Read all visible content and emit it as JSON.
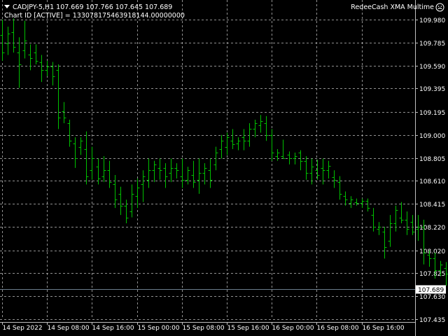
{
  "header": {
    "symbol_line": "CADJPY-5,H1  107.669 107.766 107.645 107.689",
    "chart_id": "Chart ID [ACTIVE] = 133078175463918144.00000000",
    "indicator_label": "RedeeCash XMA Multime"
  },
  "icons": {
    "menu": "chevron-down-icon",
    "indicator": "smiley-icon"
  },
  "colors": {
    "background": "#000000",
    "candle": "#00c000",
    "grid": "#c0c0c0",
    "current_price_line": "#6b7c8c",
    "price_label_bg": "#ffffff",
    "text": "#ffffff"
  },
  "current_price": {
    "value": 107.689,
    "label": "107.689"
  },
  "chart_data": {
    "type": "bar",
    "symbol": "CADJPY-5",
    "timeframe": "H1",
    "ylim": [
      107.435,
      109.98
    ],
    "y_ticks": [
      109.98,
      109.785,
      109.59,
      109.395,
      109.195,
      109.0,
      108.805,
      108.61,
      108.415,
      108.22,
      108.02,
      107.825,
      107.63,
      107.435
    ],
    "x_tick_labels": [
      "14 Sep 2022",
      "14 Sep 08:00",
      "14 Sep 16:00",
      "15 Sep 00:00",
      "15 Sep 08:00",
      "15 Sep 16:00",
      "16 Sep 00:00",
      "16 Sep 08:00",
      "16 Sep 16:00"
    ],
    "grid": true,
    "bars": [
      {
        "open": 109.85,
        "high": 109.98,
        "low": 109.63,
        "close": 109.7
      },
      {
        "open": 109.78,
        "high": 109.92,
        "low": 109.68,
        "close": 109.86
      },
      {
        "open": 109.87,
        "high": 109.99,
        "low": 109.7,
        "close": 109.75
      },
      {
        "open": 109.7,
        "high": 109.83,
        "low": 109.4,
        "close": 109.6
      },
      {
        "open": 109.72,
        "high": 109.97,
        "low": 109.65,
        "close": 109.8
      },
      {
        "open": 109.68,
        "high": 109.77,
        "low": 109.55,
        "close": 109.65
      },
      {
        "open": 109.7,
        "high": 109.77,
        "low": 109.6,
        "close": 109.63
      },
      {
        "open": 109.62,
        "high": 109.68,
        "low": 109.45,
        "close": 109.55
      },
      {
        "open": 109.55,
        "high": 109.63,
        "low": 109.5,
        "close": 109.58
      },
      {
        "open": 109.58,
        "high": 109.62,
        "low": 109.42,
        "close": 109.5
      },
      {
        "open": 109.55,
        "high": 109.6,
        "low": 109.05,
        "close": 109.15
      },
      {
        "open": 109.2,
        "high": 109.28,
        "low": 109.1,
        "close": 109.15
      },
      {
        "open": 109.1,
        "high": 109.13,
        "low": 108.9,
        "close": 108.95
      },
      {
        "open": 108.93,
        "high": 108.98,
        "low": 108.72,
        "close": 108.8
      },
      {
        "open": 108.9,
        "high": 108.98,
        "low": 108.83,
        "close": 108.95
      },
      {
        "open": 108.88,
        "high": 109.03,
        "low": 108.58,
        "close": 108.65
      },
      {
        "open": 108.7,
        "high": 108.9,
        "low": 108.62,
        "close": 108.8
      },
      {
        "open": 108.73,
        "high": 108.8,
        "low": 108.58,
        "close": 108.63
      },
      {
        "open": 108.65,
        "high": 108.82,
        "low": 108.6,
        "close": 108.7
      },
      {
        "open": 108.7,
        "high": 108.78,
        "low": 108.55,
        "close": 108.6
      },
      {
        "open": 108.58,
        "high": 108.66,
        "low": 108.38,
        "close": 108.45
      },
      {
        "open": 108.5,
        "high": 108.56,
        "low": 108.32,
        "close": 108.4
      },
      {
        "open": 108.4,
        "high": 108.45,
        "low": 108.25,
        "close": 108.3
      },
      {
        "open": 108.35,
        "high": 108.58,
        "low": 108.3,
        "close": 108.5
      },
      {
        "open": 108.48,
        "high": 108.63,
        "low": 108.38,
        "close": 108.55
      },
      {
        "open": 108.58,
        "high": 108.7,
        "low": 108.43,
        "close": 108.65
      },
      {
        "open": 108.62,
        "high": 108.8,
        "low": 108.55,
        "close": 108.7
      },
      {
        "open": 108.7,
        "high": 108.78,
        "low": 108.6,
        "close": 108.75
      },
      {
        "open": 108.72,
        "high": 108.8,
        "low": 108.62,
        "close": 108.7
      },
      {
        "open": 108.72,
        "high": 108.76,
        "low": 108.55,
        "close": 108.65
      },
      {
        "open": 108.68,
        "high": 108.8,
        "low": 108.6,
        "close": 108.72
      },
      {
        "open": 108.72,
        "high": 108.76,
        "low": 108.63,
        "close": 108.7
      },
      {
        "open": 108.65,
        "high": 108.8,
        "low": 108.55,
        "close": 108.62
      },
      {
        "open": 108.62,
        "high": 108.73,
        "low": 108.58,
        "close": 108.7
      },
      {
        "open": 108.66,
        "high": 108.78,
        "low": 108.55,
        "close": 108.6
      },
      {
        "open": 108.62,
        "high": 108.8,
        "low": 108.5,
        "close": 108.68
      },
      {
        "open": 108.68,
        "high": 108.76,
        "low": 108.58,
        "close": 108.72
      },
      {
        "open": 108.7,
        "high": 108.8,
        "low": 108.55,
        "close": 108.62
      },
      {
        "open": 108.75,
        "high": 108.9,
        "low": 108.7,
        "close": 108.85
      },
      {
        "open": 108.88,
        "high": 109.0,
        "low": 108.8,
        "close": 108.95
      },
      {
        "open": 108.9,
        "high": 109.02,
        "low": 108.83,
        "close": 108.98
      },
      {
        "open": 108.95,
        "high": 109.05,
        "low": 108.88,
        "close": 108.92
      },
      {
        "open": 108.93,
        "high": 108.98,
        "low": 108.87,
        "close": 108.95
      },
      {
        "open": 108.98,
        "high": 109.05,
        "low": 108.87,
        "close": 108.95
      },
      {
        "open": 108.95,
        "high": 109.1,
        "low": 108.9,
        "close": 109.05
      },
      {
        "open": 109.05,
        "high": 109.13,
        "low": 108.98,
        "close": 109.1
      },
      {
        "open": 109.08,
        "high": 109.17,
        "low": 109.02,
        "close": 109.12
      },
      {
        "open": 109.1,
        "high": 109.16,
        "low": 108.95,
        "close": 109.0
      },
      {
        "open": 109.0,
        "high": 109.05,
        "low": 108.78,
        "close": 108.85
      },
      {
        "open": 108.82,
        "high": 108.88,
        "low": 108.78,
        "close": 108.85
      },
      {
        "open": 108.82,
        "high": 108.96,
        "low": 108.8,
        "close": 108.8
      },
      {
        "open": 108.83,
        "high": 108.86,
        "low": 108.75,
        "close": 108.8
      },
      {
        "open": 108.8,
        "high": 108.85,
        "low": 108.75,
        "close": 108.82
      },
      {
        "open": 108.85,
        "high": 108.87,
        "low": 108.7,
        "close": 108.78
      },
      {
        "open": 108.78,
        "high": 108.82,
        "low": 108.62,
        "close": 108.68
      },
      {
        "open": 108.68,
        "high": 108.8,
        "low": 108.58,
        "close": 108.73
      },
      {
        "open": 108.7,
        "high": 108.79,
        "low": 108.62,
        "close": 108.66
      },
      {
        "open": 108.72,
        "high": 108.8,
        "low": 108.58,
        "close": 108.7
      },
      {
        "open": 108.7,
        "high": 108.78,
        "low": 108.63,
        "close": 108.74
      },
      {
        "open": 108.64,
        "high": 108.7,
        "low": 108.55,
        "close": 108.62
      },
      {
        "open": 108.6,
        "high": 108.65,
        "low": 108.45,
        "close": 108.5
      },
      {
        "open": 108.48,
        "high": 108.52,
        "low": 108.4,
        "close": 108.45
      },
      {
        "open": 108.42,
        "high": 108.48,
        "low": 108.38,
        "close": 108.45
      },
      {
        "open": 108.43,
        "high": 108.46,
        "low": 108.4,
        "close": 108.42
      },
      {
        "open": 108.42,
        "high": 108.46,
        "low": 108.38,
        "close": 108.44
      },
      {
        "open": 108.44,
        "high": 108.46,
        "low": 108.35,
        "close": 108.38
      },
      {
        "open": 108.32,
        "high": 108.38,
        "low": 108.18,
        "close": 108.22
      },
      {
        "open": 108.2,
        "high": 108.26,
        "low": 108.15,
        "close": 108.22
      },
      {
        "open": 108.18,
        "high": 108.22,
        "low": 107.95,
        "close": 108.05
      },
      {
        "open": 108.1,
        "high": 108.32,
        "low": 108.05,
        "close": 108.25
      },
      {
        "open": 108.25,
        "high": 108.4,
        "low": 108.18,
        "close": 108.36
      },
      {
        "open": 108.3,
        "high": 108.43,
        "low": 108.25,
        "close": 108.28
      },
      {
        "open": 108.28,
        "high": 108.35,
        "low": 108.15,
        "close": 108.2
      },
      {
        "open": 108.26,
        "high": 108.32,
        "low": 108.15,
        "close": 108.18
      },
      {
        "open": 108.2,
        "high": 108.32,
        "low": 108.1,
        "close": 108.22
      },
      {
        "open": 108.22,
        "high": 108.28,
        "low": 107.9,
        "close": 108.0
      },
      {
        "open": 107.98,
        "high": 108.02,
        "low": 107.88,
        "close": 107.95
      },
      {
        "open": 107.95,
        "high": 108.0,
        "low": 107.78,
        "close": 107.85
      },
      {
        "open": 107.85,
        "high": 107.93,
        "low": 107.8,
        "close": 107.9
      },
      {
        "open": 107.87,
        "high": 107.92,
        "low": 107.72,
        "close": 107.82
      },
      {
        "open": 107.82,
        "high": 107.85,
        "low": 107.62,
        "close": 107.7
      },
      {
        "open": 107.72,
        "high": 107.82,
        "low": 107.68,
        "close": 107.74
      },
      {
        "open": 107.72,
        "high": 107.77,
        "low": 107.6,
        "close": 107.65
      },
      {
        "open": 107.65,
        "high": 107.75,
        "low": 107.53,
        "close": 107.6
      },
      {
        "open": 107.62,
        "high": 107.78,
        "low": 107.55,
        "close": 107.7
      },
      {
        "open": 107.68,
        "high": 107.77,
        "low": 107.56,
        "close": 107.63
      },
      {
        "open": 107.63,
        "high": 107.7,
        "low": 107.57,
        "close": 107.62
      },
      {
        "open": 107.6,
        "high": 107.75,
        "low": 107.55,
        "close": 107.7
      },
      {
        "open": 107.66,
        "high": 107.73,
        "low": 107.62,
        "close": 107.68
      },
      {
        "open": 107.68,
        "high": 107.73,
        "low": 107.48,
        "close": 107.53
      },
      {
        "open": 107.58,
        "high": 107.66,
        "low": 107.52,
        "close": 107.62
      },
      {
        "open": 107.63,
        "high": 107.68,
        "low": 107.58,
        "close": 107.6
      },
      {
        "open": 107.62,
        "high": 107.77,
        "low": 107.6,
        "close": 107.69
      }
    ]
  }
}
